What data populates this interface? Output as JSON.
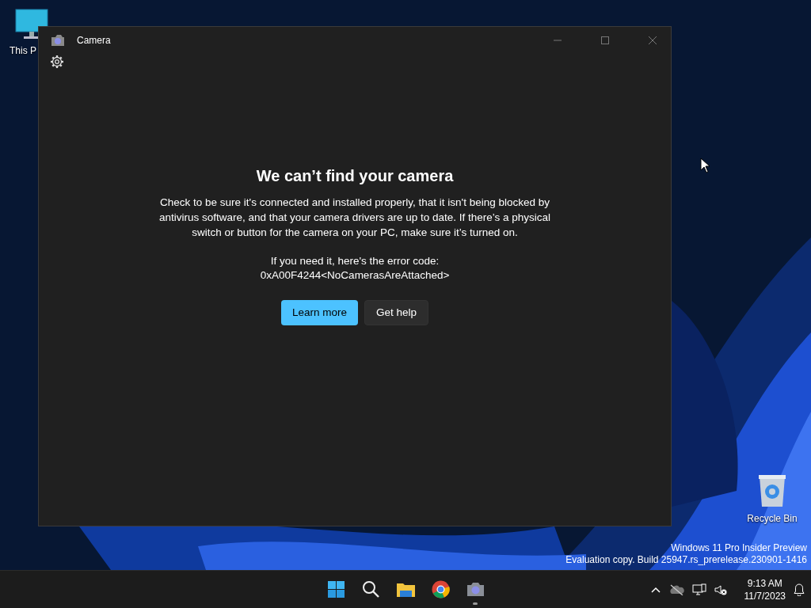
{
  "desktop_icons": [
    {
      "kind": "pc",
      "label": "This P"
    },
    {
      "kind": "bin",
      "label": "Recycle Bin"
    }
  ],
  "window": {
    "title": "Camera",
    "heading": "We can’t find your camera",
    "message": "Check to be sure it's connected and installed properly, that it isn't being blocked by antivirus software, and that your camera drivers are up to date. If there’s a physical switch or button for the camera on your PC, make sure it’s turned on.",
    "code_intro": "If you need it, here's the error code:",
    "code": "0xA00F4244<NoCamerasAreAttached>",
    "buttons": [
      {
        "kind": "primary",
        "label": "Learn more"
      },
      {
        "kind": "secondary",
        "label": "Get help"
      }
    ]
  },
  "evaluation_notice": [
    "Windows 11 Pro Insider Preview",
    "Evaluation copy. Build 25947.rs_prerelease.230901-1416"
  ],
  "taskbar": {
    "apps": [
      {
        "kind": "start",
        "running": false
      },
      {
        "kind": "search",
        "running": false
      },
      {
        "kind": "folder",
        "running": false
      },
      {
        "kind": "browser",
        "running": false
      },
      {
        "kind": "camera",
        "running": true
      }
    ],
    "time": "9:13 AM",
    "date": "11/7/2023"
  }
}
